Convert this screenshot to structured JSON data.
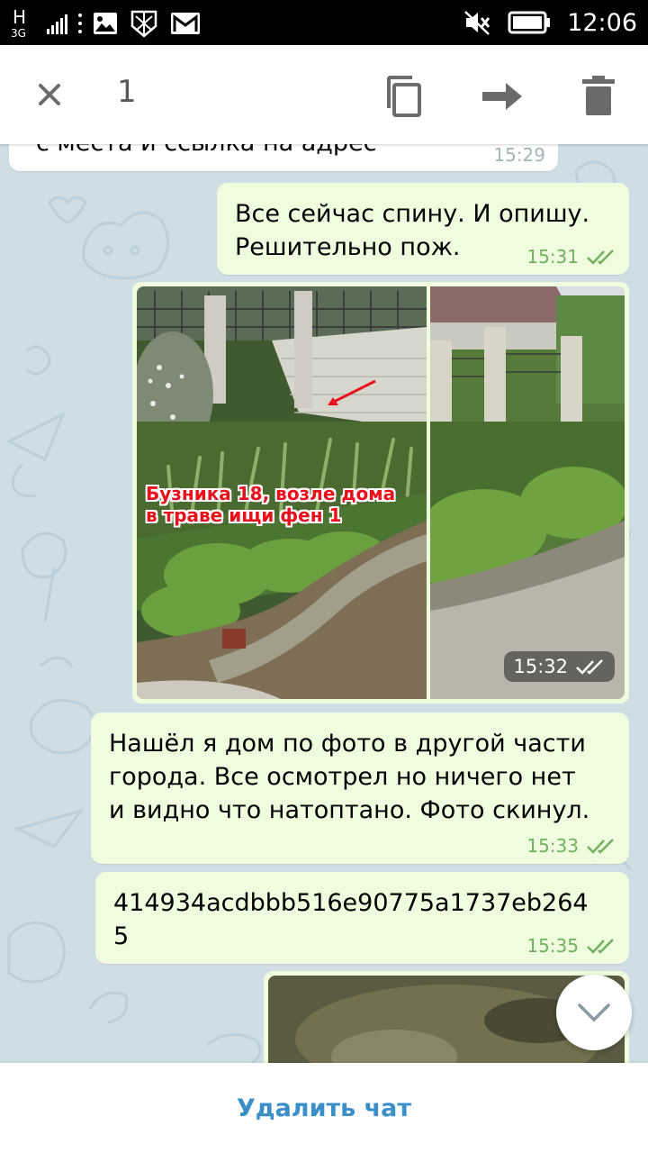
{
  "status_bar": {
    "network_type_letter": "H",
    "network_gen": "3G",
    "time": "12:06",
    "icons": [
      "gallery-icon",
      "app-shield-icon",
      "gmail-icon",
      "mute-icon",
      "battery-icon"
    ]
  },
  "action_bar": {
    "selected_count": "1",
    "icons": [
      "close-icon",
      "copy-icon",
      "forward-icon",
      "delete-icon"
    ]
  },
  "messages": [
    {
      "id": "m0",
      "direction": "in",
      "text": "с места и ссылка на адрес",
      "time": "15:29"
    },
    {
      "id": "m1",
      "direction": "out",
      "text_lines": [
        "Все сейчас спину. И опишу.",
        "Решительно пож."
      ],
      "time": "15:31",
      "status": "read"
    },
    {
      "id": "m2",
      "direction": "out",
      "type": "photos",
      "caption_lines": [
        "Бузника 18, возле дома",
        "в траве ищи фен 1"
      ],
      "time": "15:32",
      "status": "read"
    },
    {
      "id": "m3",
      "direction": "out",
      "text_lines": [
        "Нашёл я дом по фото в другой части",
        "города. Все осмотрел но ничего нет",
        "и видно что натоптано. Фото скинул."
      ],
      "time": "15:33",
      "status": "read"
    },
    {
      "id": "m4",
      "direction": "out",
      "text_lines": [
        "414934acdbbb516e90775a1737eb264",
        "5"
      ],
      "time": "15:35",
      "status": "read"
    },
    {
      "id": "m5",
      "direction": "out",
      "type": "photo"
    }
  ],
  "bottom_bar": {
    "delete_chat_label": "Удалить чат"
  },
  "colors": {
    "chat_background": "#cfdee5",
    "outgoing_bubble": "#effdde",
    "incoming_bubble": "#ffffff",
    "time_green": "#72b15f",
    "accent_blue": "#3a8fc9"
  }
}
